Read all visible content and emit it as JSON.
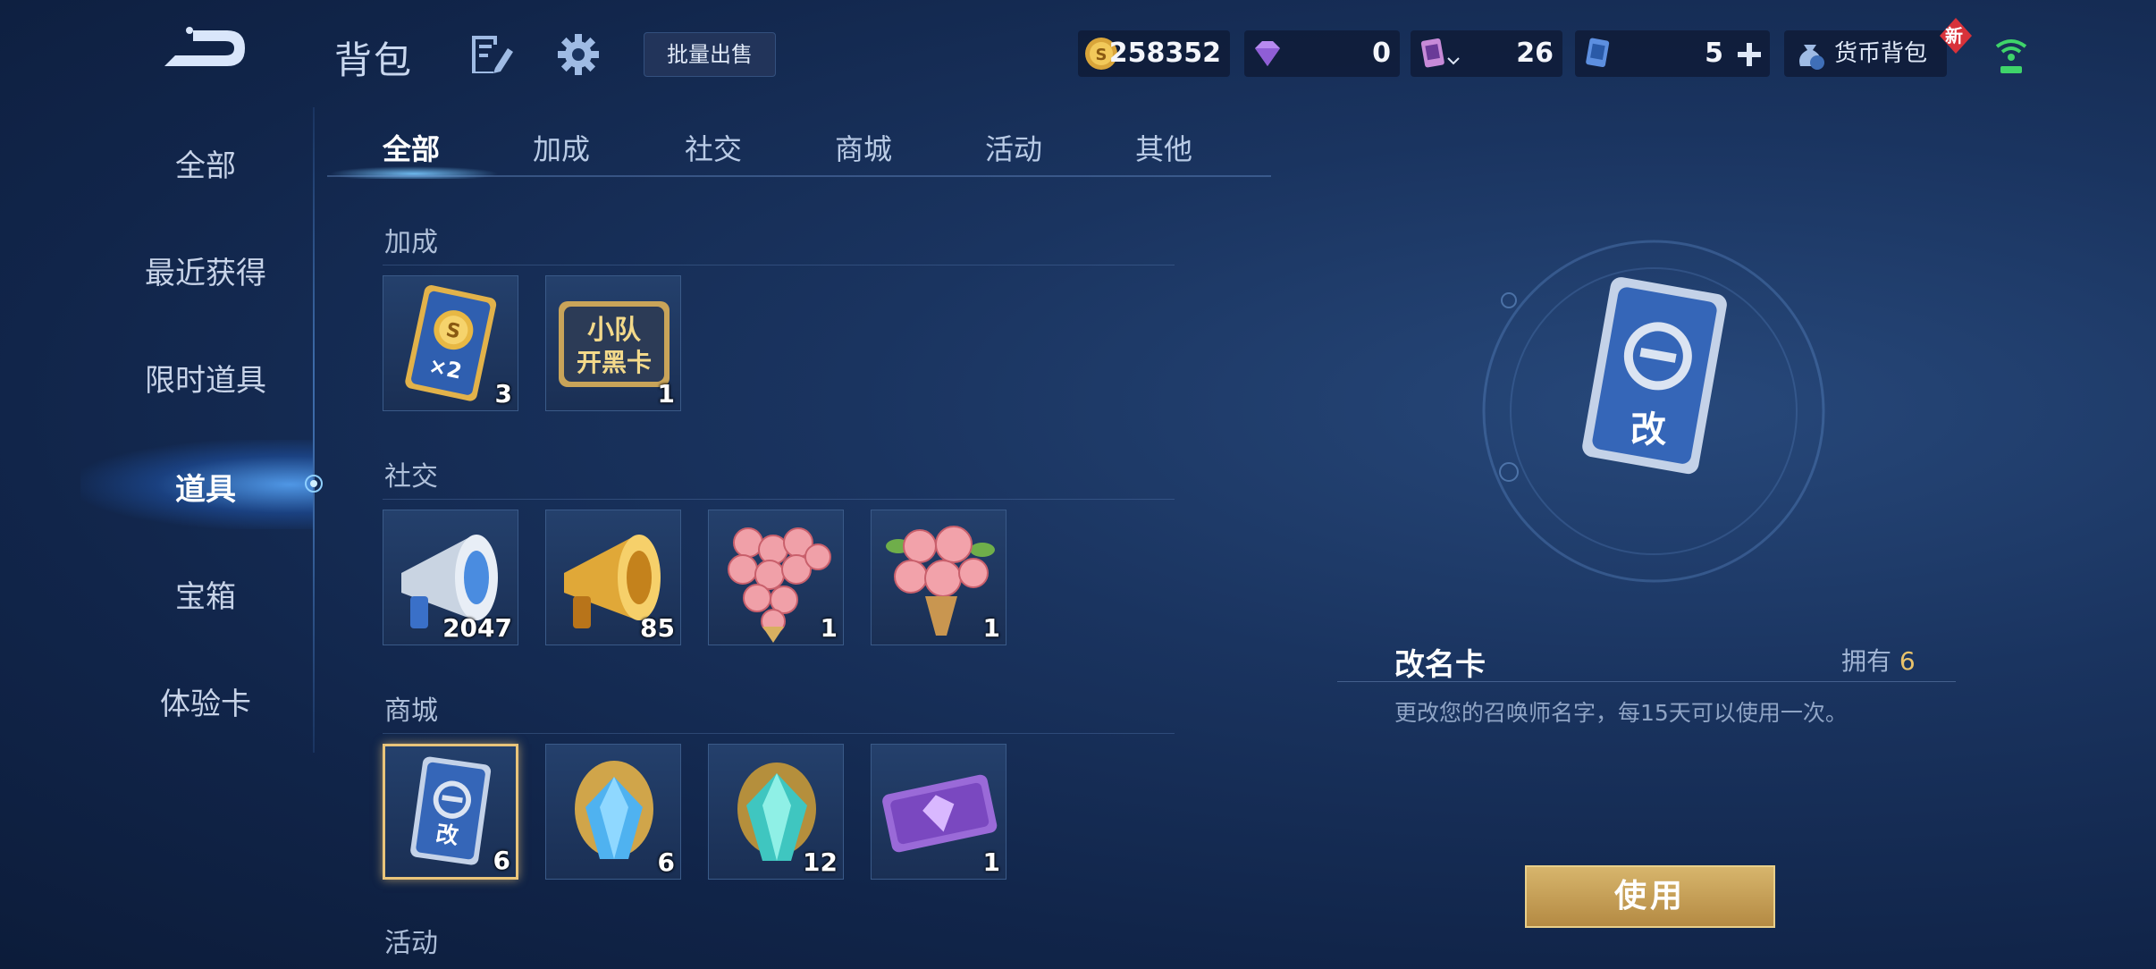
{
  "header": {
    "title": "背包",
    "bulk_sell_label": "批量出售",
    "gold": "258352",
    "diamond": "0",
    "tickets": "26",
    "cards": "5",
    "currency_bag_label": "货币背包",
    "new_badge": "新"
  },
  "sidebar": {
    "items": [
      {
        "label": "全部"
      },
      {
        "label": "最近获得"
      },
      {
        "label": "限时道具"
      },
      {
        "label": "道具"
      },
      {
        "label": "宝箱"
      },
      {
        "label": "体验卡"
      }
    ],
    "active": "道具"
  },
  "tabs": {
    "items": [
      {
        "label": "全部"
      },
      {
        "label": "加成"
      },
      {
        "label": "社交"
      },
      {
        "label": "商城"
      },
      {
        "label": "活动"
      },
      {
        "label": "其他"
      }
    ],
    "active": "全部"
  },
  "sections": {
    "boost": {
      "title": "加成",
      "items": [
        {
          "icon": "double-gold-card-icon",
          "count": "3"
        },
        {
          "icon": "squad-blackcard-icon",
          "label": "小队\n开黑卡",
          "count": "1"
        }
      ]
    },
    "social": {
      "title": "社交",
      "items": [
        {
          "icon": "silver-horn-icon",
          "count": "2047"
        },
        {
          "icon": "gold-horn-icon",
          "count": "85"
        },
        {
          "icon": "rose-heart-icon",
          "count": "1"
        },
        {
          "icon": "rose-bouquet-icon",
          "count": "1"
        }
      ]
    },
    "shop": {
      "title": "商城",
      "items": [
        {
          "icon": "rename-card-icon",
          "count": "6",
          "selected": true
        },
        {
          "icon": "blue-crystal-icon",
          "count": "6"
        },
        {
          "icon": "teal-crystal-icon",
          "count": "12"
        },
        {
          "icon": "purple-ticket-icon",
          "count": "1"
        }
      ]
    },
    "event": {
      "title": "活动"
    }
  },
  "detail": {
    "icon": "rename-card-icon",
    "card_glyph": "改",
    "name": "改名卡",
    "own_label": "拥有",
    "own_count": "6",
    "description": "更改您的召唤师名字，每15天可以使用一次。",
    "use_label": "使用"
  },
  "colors": {
    "accent_gold": "#e9c36b",
    "background": "#1a3460",
    "selected_border": "#e9c47a"
  }
}
